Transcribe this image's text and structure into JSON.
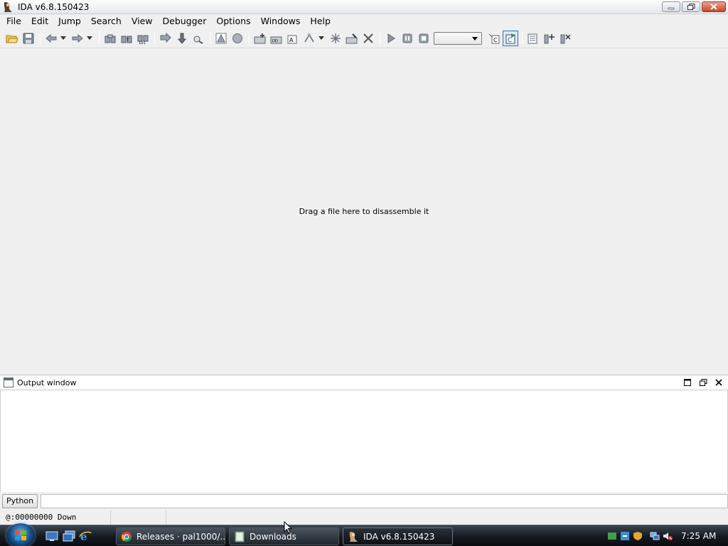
{
  "window": {
    "title": "IDA v6.8.150423"
  },
  "menu": [
    "File",
    "Edit",
    "Jump",
    "Search",
    "View",
    "Debugger",
    "Options",
    "Windows",
    "Help"
  ],
  "main": {
    "hint": "Drag a file here to disassemble it"
  },
  "output": {
    "title": "Output window"
  },
  "python": {
    "button_label": "Python",
    "input_value": ""
  },
  "status": {
    "address": "@:00000000",
    "direction": "Down"
  },
  "debugger_select": {
    "selected": ""
  },
  "taskbar": {
    "items": [
      {
        "label": "Releases · pal1000/...",
        "icon": "chrome-icon"
      },
      {
        "label": "Downloads",
        "icon": "folder-icon"
      },
      {
        "label": "IDA v6.8.150423",
        "icon": "ida-icon"
      }
    ],
    "clock": "7:25 AM"
  },
  "colors": {
    "taskbar": "#15191f",
    "close_button": "#c9452a",
    "accent": "#1e5a9a"
  }
}
